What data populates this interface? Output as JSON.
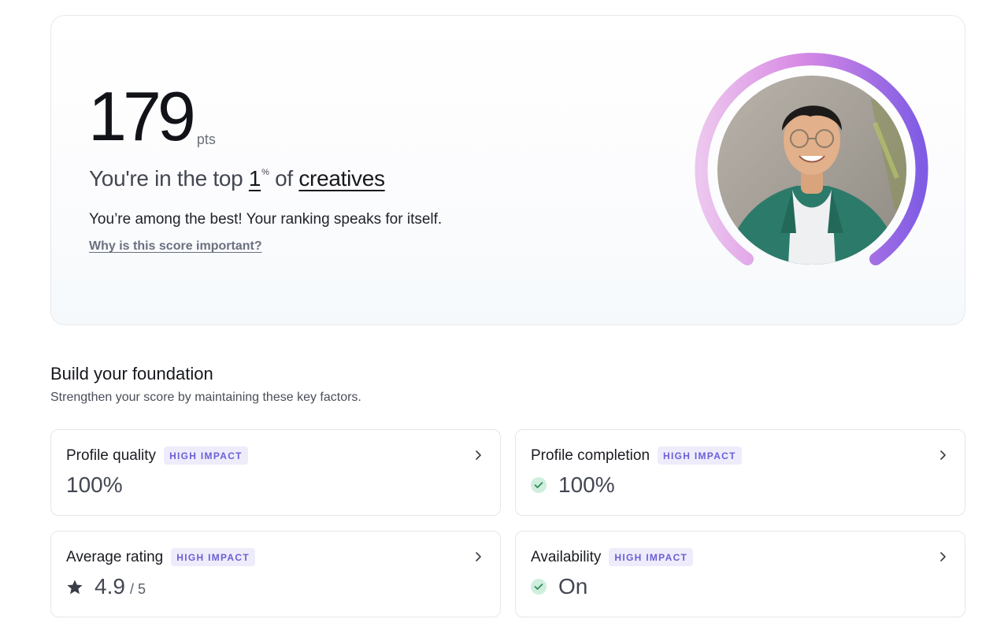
{
  "hero": {
    "score": "179",
    "score_unit": "pts",
    "rank_prefix": "You're in the top ",
    "rank_value": "1",
    "rank_unit": "%",
    "rank_middle": " of ",
    "rank_group": "creatives",
    "description": "You’re among the best! Your ranking speaks for itself.",
    "why_link": "Why is this score important?"
  },
  "foundation": {
    "title": "Build your foundation",
    "subtitle": "Strengthen your score by maintaining these key factors."
  },
  "cards": [
    {
      "title": "Profile quality",
      "badge": "HIGH IMPACT",
      "value": "100%",
      "icon": "none"
    },
    {
      "title": "Profile completion",
      "badge": "HIGH IMPACT",
      "value": "100%",
      "icon": "check-icon"
    },
    {
      "title": "Average rating",
      "badge": "HIGH IMPACT",
      "value": "4.9",
      "value_sub": "/ 5",
      "icon": "star-icon"
    },
    {
      "title": "Availability",
      "badge": "HIGH IMPACT",
      "value": "On",
      "icon": "check-icon"
    }
  ],
  "colors": {
    "ring_start": "#f0c8f0",
    "ring_mid": "#d27ee2",
    "ring_end": "#7f5ce4",
    "badge_bg": "#eeecfb",
    "badge_text": "#6a5fd6",
    "check_bg": "#cfeedd",
    "check_mark": "#2f8a55"
  }
}
